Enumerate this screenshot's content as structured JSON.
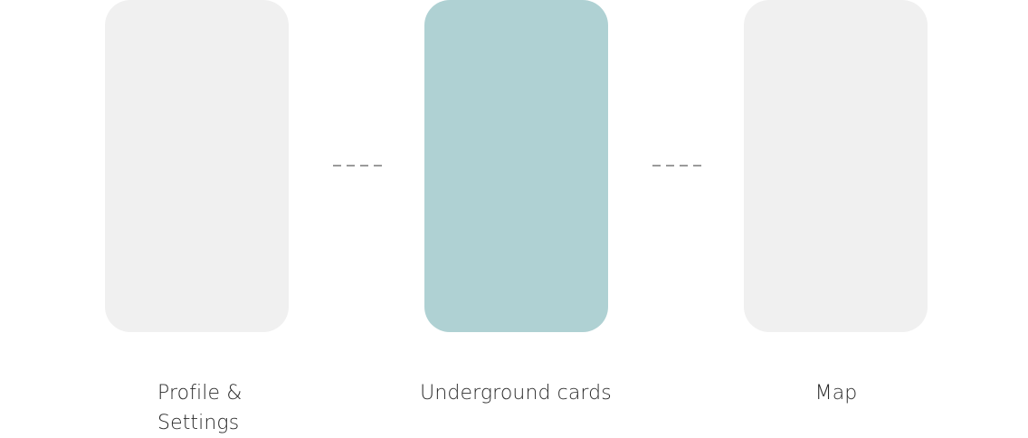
{
  "screens": [
    {
      "id": "profile",
      "label": "Profile & Settings",
      "label_line1": "Profile &",
      "label_line2": "Settings",
      "color": "#f0f0f0",
      "highlighted": false
    },
    {
      "id": "underground",
      "label": "Underground cards",
      "color": "#afd1d3",
      "highlighted": true
    },
    {
      "id": "map",
      "label": "Map",
      "color": "#f0f0f0",
      "highlighted": false
    }
  ],
  "connector_color": "#9a9a9a",
  "text_color": "#2b2b2b"
}
